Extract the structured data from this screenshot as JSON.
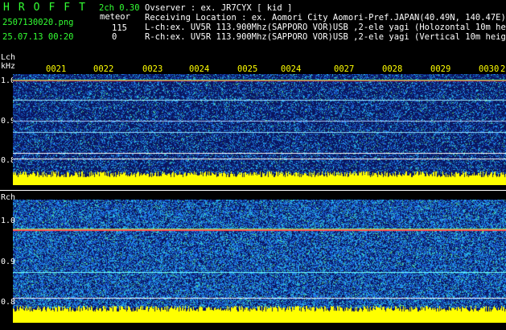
{
  "header": {
    "logo": "HROFFT",
    "filename": "2507130020.png",
    "datetime": "25.07.13 00:20",
    "version": "2ch 0.30",
    "meteor_label": "meteor",
    "meteor_count_l": "115",
    "meteor_count_r": "0"
  },
  "info": {
    "observer": "Ovserver          : ex. JR7CYX [ kid ]",
    "location": "Receiving Location : ex. Aomori City Aomori-Pref.JAPAN(40.49N, 140.47E)",
    "lch": "L-ch:ex. UV5R 113.900Mhz(SAPPORO VOR)USB ,2-ele yagi (Holozontal 10m height)",
    "rch": "R-ch:ex. UV5R 113.900Mhz(SAPPORO VOR)USB ,2-ele yagi (Vertical 10m height)"
  },
  "panels": {
    "lch": {
      "label": "Lch",
      "unit": "kHz"
    },
    "rch": {
      "label": "Rch"
    }
  },
  "y_ticks": [
    "1.0",
    "0.9",
    "0.8"
  ],
  "x_ticks": [
    "0021",
    "0022",
    "0023",
    "0024",
    "0025",
    "0024",
    "0027",
    "0028",
    "0029",
    "0030"
  ],
  "x_tick_end": "2",
  "colors": {
    "background": "#000000",
    "logo": "#33ff33",
    "ticks": "#ffff00",
    "spectrogram_low": "#0a1a6e",
    "spectrogram_high": "#ff3030",
    "activity_bar": "#ffff00"
  }
}
